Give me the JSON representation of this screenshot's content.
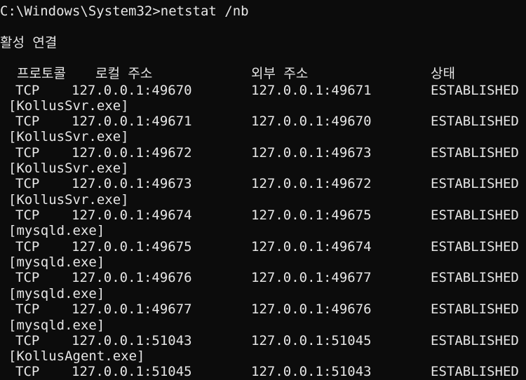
{
  "prompt_line": "C:\\Windows\\System32>netstat /nb",
  "section_title": "활성 연결",
  "headers": {
    "proto": "프로토콜",
    "local": "로컬 주소",
    "foreign": "외부 주소",
    "state": "상태"
  },
  "rows": [
    {
      "proto": "TCP",
      "local": "127.0.0.1:49670",
      "foreign": "127.0.0.1:49671",
      "state": "ESTABLISHED",
      "exe": "[KollusSvr.exe]"
    },
    {
      "proto": "TCP",
      "local": "127.0.0.1:49671",
      "foreign": "127.0.0.1:49670",
      "state": "ESTABLISHED",
      "exe": "[KollusSvr.exe]"
    },
    {
      "proto": "TCP",
      "local": "127.0.0.1:49672",
      "foreign": "127.0.0.1:49673",
      "state": "ESTABLISHED",
      "exe": "[KollusSvr.exe]"
    },
    {
      "proto": "TCP",
      "local": "127.0.0.1:49673",
      "foreign": "127.0.0.1:49672",
      "state": "ESTABLISHED",
      "exe": "[KollusSvr.exe]"
    },
    {
      "proto": "TCP",
      "local": "127.0.0.1:49674",
      "foreign": "127.0.0.1:49675",
      "state": "ESTABLISHED",
      "exe": "[mysqld.exe]"
    },
    {
      "proto": "TCP",
      "local": "127.0.0.1:49675",
      "foreign": "127.0.0.1:49674",
      "state": "ESTABLISHED",
      "exe": "[mysqld.exe]"
    },
    {
      "proto": "TCP",
      "local": "127.0.0.1:49676",
      "foreign": "127.0.0.1:49677",
      "state": "ESTABLISHED",
      "exe": "[mysqld.exe]"
    },
    {
      "proto": "TCP",
      "local": "127.0.0.1:49677",
      "foreign": "127.0.0.1:49676",
      "state": "ESTABLISHED",
      "exe": "[mysqld.exe]"
    },
    {
      "proto": "TCP",
      "local": "127.0.0.1:51043",
      "foreign": "127.0.0.1:51045",
      "state": "ESTABLISHED",
      "exe": "[KollusAgent.exe]"
    },
    {
      "proto": "TCP",
      "local": "127.0.0.1:51045",
      "foreign": "127.0.0.1:51043",
      "state": "ESTABLISHED",
      "exe": ""
    }
  ],
  "colors": {
    "background": "#0c0c0c",
    "text": "#e6e6e6"
  }
}
